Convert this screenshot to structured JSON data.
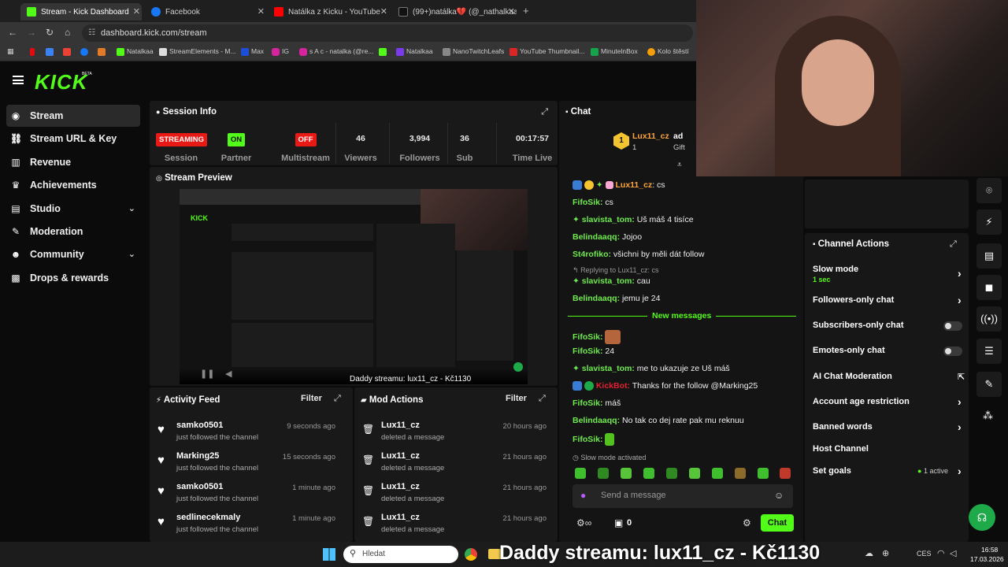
{
  "browser": {
    "tabs": [
      {
        "label": "Stream - Kick Dashboard",
        "color": "#53fc18",
        "active": true
      },
      {
        "label": "Facebook",
        "color": "#1877f2",
        "active": false
      },
      {
        "label": "Natálka z Kicku - YouTube",
        "color": "#ff0000",
        "active": false
      },
      {
        "label": "(99+)natálka💔 (@_nathalkaa)",
        "color": "#ffffff",
        "active": false
      }
    ],
    "url": "dashboard.kick.com/stream",
    "bookmarks": [
      "Natalkaa",
      "StreamElements - M...",
      "Max",
      "IG",
      "s A c - natalka (@re...",
      "Natalkaa",
      "NanoTwitchLeafs",
      "YouTube Thumbnail...",
      "MinutelnBox",
      "Kolo štěstí"
    ]
  },
  "kick": {
    "logo": "KICK",
    "beta": "BETA"
  },
  "sidebar": {
    "items": [
      {
        "label": "Stream",
        "icon": "radio-icon",
        "active": true,
        "chev": false
      },
      {
        "label": "Stream URL & Key",
        "icon": "link-icon",
        "active": false,
        "chev": false
      },
      {
        "label": "Revenue",
        "icon": "chart-icon",
        "active": false,
        "chev": false
      },
      {
        "label": "Achievements",
        "icon": "trophy-icon",
        "active": false,
        "chev": false
      },
      {
        "label": "Studio",
        "icon": "studio-icon",
        "active": false,
        "chev": true
      },
      {
        "label": "Moderation",
        "icon": "wrench-icon",
        "active": false,
        "chev": false
      },
      {
        "label": "Community",
        "icon": "community-icon",
        "active": false,
        "chev": true
      },
      {
        "label": "Drops & rewards",
        "icon": "gift-icon",
        "active": false,
        "chev": false
      }
    ]
  },
  "session": {
    "title": "Session Info",
    "stats": [
      {
        "value": "STREAMING",
        "label": "Session",
        "kind": "pill-red"
      },
      {
        "value": "ON",
        "label": "Partner",
        "kind": "pill-green"
      },
      {
        "value": "OFF",
        "label": "Multistream",
        "kind": "pill-red"
      },
      {
        "value": "46",
        "label": "Viewers",
        "kind": "num"
      },
      {
        "value": "3,994",
        "label": "Followers",
        "kind": "num"
      },
      {
        "value": "36",
        "label": "Sub",
        "kind": "num"
      },
      {
        "value": "00:17:57",
        "label": "Time Live",
        "kind": "num"
      }
    ]
  },
  "preview": {
    "title": "Stream Preview",
    "overlay": "Daddy streamu: lux11_cz - Kč1130"
  },
  "activity": {
    "title": "Activity Feed",
    "filter": "Filter",
    "items": [
      {
        "name": "samko0501",
        "sub": "just followed the channel",
        "time": "9 seconds ago"
      },
      {
        "name": "Marking25",
        "sub": "just followed the channel",
        "time": "15 seconds ago"
      },
      {
        "name": "samko0501",
        "sub": "just followed the channel",
        "time": "1 minute ago"
      },
      {
        "name": "sedlinecekmaly",
        "sub": "just followed the channel",
        "time": "1 minute ago"
      }
    ]
  },
  "mod": {
    "title": "Mod Actions",
    "filter": "Filter",
    "items": [
      {
        "name": "Lux11_cz",
        "sub": "deleted a message",
        "time": "20 hours ago"
      },
      {
        "name": "Lux11_cz",
        "sub": "deleted a message",
        "time": "21 hours ago"
      },
      {
        "name": "Lux11_cz",
        "sub": "deleted a message",
        "time": "21 hours ago"
      },
      {
        "name": "Lux11_cz",
        "sub": "deleted a message",
        "time": "21 hours ago"
      }
    ]
  },
  "chat": {
    "title": "Chat",
    "pinned": {
      "name": "Lux11_cz",
      "rank": "1",
      "count": "1",
      "extra1": "ad",
      "extra2": "Gift"
    },
    "messages": [
      {
        "user": "Lux11_cz",
        "text": ": cs",
        "color": "orange"
      },
      {
        "user": "FifoSik:",
        "text": " cs",
        "color": "green"
      },
      {
        "user": "slavista_tom:",
        "text": " Uš máš 4 tisíce",
        "color": "green"
      },
      {
        "user": "Belindaaqq:",
        "text": " Jojoo",
        "color": "green"
      },
      {
        "user": "St4rofiko:",
        "text": " všichni by měli dát follow",
        "color": "green"
      },
      {
        "user": "Replying to Lux11_cz: cs",
        "text": "",
        "color": "reply"
      },
      {
        "user": "slavista_tom:",
        "text": " cau",
        "color": "green"
      },
      {
        "user": "Belindaaqq:",
        "text": " jemu je 24",
        "color": "green"
      },
      {
        "user": "New messages",
        "text": "",
        "color": "divider"
      },
      {
        "user": "FifoSik:",
        "text": "",
        "color": "green"
      },
      {
        "user": "FifoSik:",
        "text": " 24",
        "color": "green"
      },
      {
        "user": "slavista_tom:",
        "text": " me to ukazuje ze Uš máš",
        "color": "green"
      },
      {
        "user": "KickBot:",
        "text": " Thanks for the follow @Marking25",
        "color": "red"
      },
      {
        "user": "FifoSik:",
        "text": " máš",
        "color": "green"
      },
      {
        "user": "Belindaaqq:",
        "text": " No tak co dej rate pak mu reknuu",
        "color": "green"
      },
      {
        "user": "FifoSik:",
        "text": "",
        "color": "green"
      }
    ],
    "slow_mode_notice": "Slow mode activated",
    "placeholder": "Send a message",
    "count": "0",
    "send": "Chat"
  },
  "channel_actions": {
    "title": "Channel Actions",
    "items": [
      {
        "label": "Slow mode",
        "sub": "1 sec",
        "kind": "arrow"
      },
      {
        "label": "Followers-only chat",
        "sub": "",
        "kind": "arrow"
      },
      {
        "label": "Subscribers-only chat",
        "sub": "",
        "kind": "toggle"
      },
      {
        "label": "Emotes-only chat",
        "sub": "",
        "kind": "toggle"
      },
      {
        "label": "AI Chat Moderation",
        "sub": "",
        "kind": "external"
      },
      {
        "label": "Account age restriction",
        "sub": "",
        "kind": "arrow"
      },
      {
        "label": "Banned words",
        "sub": "",
        "kind": "arrow"
      },
      {
        "label": "Host Channel",
        "sub": "",
        "kind": "none"
      },
      {
        "label": "Set goals",
        "sub": "1 active",
        "kind": "arrow"
      }
    ]
  },
  "taskbar": {
    "search": "Hledat",
    "ticker": "Daddy streamu: lux11_cz - Kč1130",
    "lang": "CES",
    "time": "16:58",
    "date": "17.03.2026"
  },
  "colors": {
    "accent": "#53fc18",
    "live": "#e91916",
    "panel": "#191919"
  }
}
